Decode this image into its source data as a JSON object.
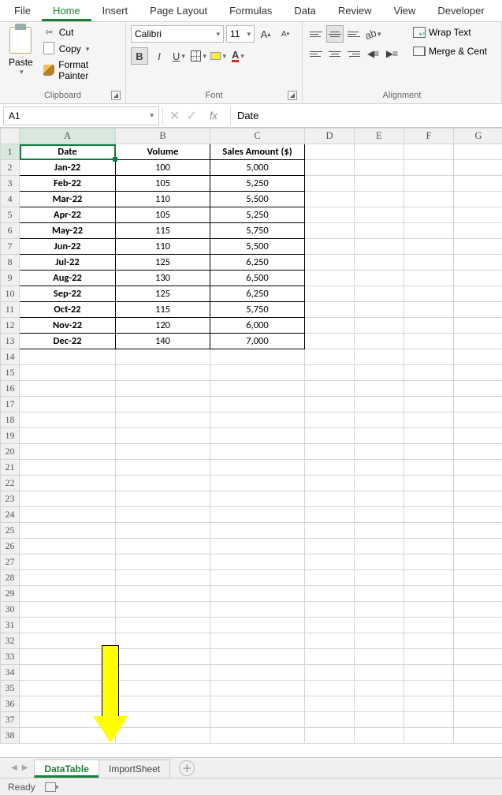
{
  "ribbon_tabs": [
    "File",
    "Home",
    "Insert",
    "Page Layout",
    "Formulas",
    "Data",
    "Review",
    "View",
    "Developer"
  ],
  "active_tab_index": 1,
  "clipboard": {
    "paste": "Paste",
    "cut": "Cut",
    "copy": "Copy",
    "format_painter": "Format Painter",
    "group_label": "Clipboard"
  },
  "font": {
    "name": "Calibri",
    "size": "11",
    "group_label": "Font"
  },
  "alignment": {
    "wrap": "Wrap Text",
    "merge": "Merge & Cent",
    "group_label": "Alignment"
  },
  "namebox": "A1",
  "formula_value": "Date",
  "columns": [
    "A",
    "B",
    "C",
    "D",
    "E",
    "F",
    "G"
  ],
  "headers": [
    "Date",
    "Volume",
    "Sales Amount ($)"
  ],
  "rows": [
    {
      "date": "Jan-22",
      "volume": "100",
      "sales": "5,000"
    },
    {
      "date": "Feb-22",
      "volume": "105",
      "sales": "5,250"
    },
    {
      "date": "Mar-22",
      "volume": "110",
      "sales": "5,500"
    },
    {
      "date": "Apr-22",
      "volume": "105",
      "sales": "5,250"
    },
    {
      "date": "May-22",
      "volume": "115",
      "sales": "5,750"
    },
    {
      "date": "Jun-22",
      "volume": "110",
      "sales": "5,500"
    },
    {
      "date": "Jul-22",
      "volume": "125",
      "sales": "6,250"
    },
    {
      "date": "Aug-22",
      "volume": "130",
      "sales": "6,500"
    },
    {
      "date": "Sep-22",
      "volume": "125",
      "sales": "6,250"
    },
    {
      "date": "Oct-22",
      "volume": "115",
      "sales": "5,750"
    },
    {
      "date": "Nov-22",
      "volume": "120",
      "sales": "6,000"
    },
    {
      "date": "Dec-22",
      "volume": "140",
      "sales": "7,000"
    }
  ],
  "total_visible_rows": 38,
  "sheet_tabs": [
    "DataTable",
    "ImportSheet"
  ],
  "active_sheet_index": 0,
  "status_text": "Ready",
  "chart_data": {
    "type": "table",
    "title": "",
    "columns": [
      "Date",
      "Volume",
      "Sales Amount ($)"
    ],
    "data": [
      [
        "Jan-22",
        100,
        5000
      ],
      [
        "Feb-22",
        105,
        5250
      ],
      [
        "Mar-22",
        110,
        5500
      ],
      [
        "Apr-22",
        105,
        5250
      ],
      [
        "May-22",
        115,
        5750
      ],
      [
        "Jun-22",
        110,
        5500
      ],
      [
        "Jul-22",
        125,
        6250
      ],
      [
        "Aug-22",
        130,
        6500
      ],
      [
        "Sep-22",
        125,
        6250
      ],
      [
        "Oct-22",
        115,
        5750
      ],
      [
        "Nov-22",
        120,
        6000
      ],
      [
        "Dec-22",
        140,
        7000
      ]
    ]
  }
}
